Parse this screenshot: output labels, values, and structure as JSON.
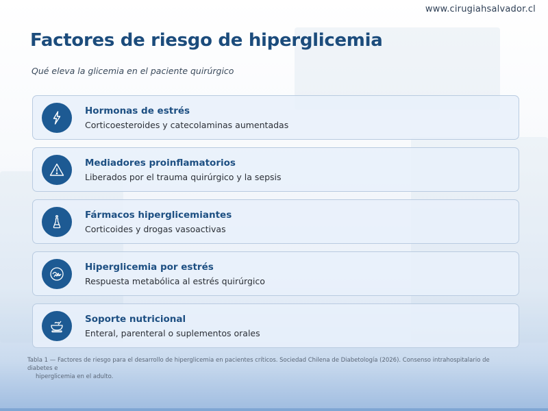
{
  "header": {
    "site_url": "www.cirugiahsalvador.cl"
  },
  "page": {
    "title": "Factores de riesgo de hiperglicemia",
    "subtitle": "Qué eleva la glicemia en el paciente quirúrgico"
  },
  "cards": [
    {
      "icon": "lightning-icon",
      "title": "Hormonas de estrés",
      "description": "Corticoesteroides y catecolaminas aumentadas"
    },
    {
      "icon": "warning-icon",
      "title": "Mediadores proinflamatorios",
      "description": "Liberados por el trauma quirúrgico y la sepsis"
    },
    {
      "icon": "flask-icon",
      "title": "Fármacos hiperglicemiantes",
      "description": "Corticoides y drogas vasoactivas"
    },
    {
      "icon": "stress-badge-icon",
      "title": "Hiperglicemia por estrés",
      "description": "Respuesta metabólica al estrés quirúrgico"
    },
    {
      "icon": "nutrition-bowl-icon",
      "title": "Soporte nutricional",
      "description": "Enteral, parenteral o suplementos orales"
    }
  ],
  "footnote": {
    "line1": "Tabla 1 — Factores de riesgo para el desarrollo de hiperglicemia en pacientes críticos. Sociedad Chilena de Diabetología (2026). Consenso intrahospitalario de diabetes e",
    "line2": "hiperglicemia en el adulto."
  },
  "colors": {
    "title": "#1c4c7c",
    "icon_bg": "#1d5a93",
    "card_bg": "#e8f0fb",
    "card_border": "#b9cbe0"
  }
}
